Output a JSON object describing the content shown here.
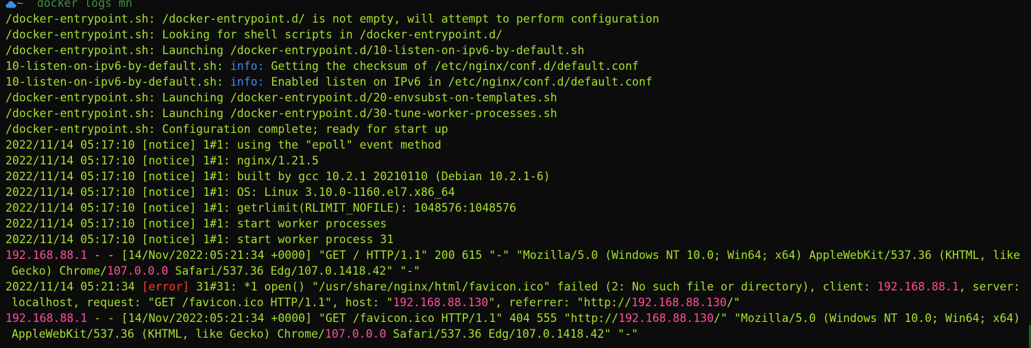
{
  "prompt": {
    "icon": "cloud-icon",
    "tilde": "~",
    "command": "docker logs mn"
  },
  "lines": [
    "/docker-entrypoint.sh: /docker-entrypoint.d/ is not empty, will attempt to perform configuration",
    "/docker-entrypoint.sh: Looking for shell scripts in /docker-entrypoint.d/",
    "/docker-entrypoint.sh: Launching /docker-entrypoint.d/10-listen-on-ipv6-by-default.sh"
  ],
  "info_lines": [
    {
      "prefix": "10-listen-on-ipv6-by-default.sh: ",
      "tag": "info:",
      "text": " Getting the checksum of /etc/nginx/conf.d/default.conf"
    },
    {
      "prefix": "10-listen-on-ipv6-by-default.sh: ",
      "tag": "info:",
      "text": " Enabled listen on IPv6 in /etc/nginx/conf.d/default.conf"
    }
  ],
  "lines2": [
    "/docker-entrypoint.sh: Launching /docker-entrypoint.d/20-envsubst-on-templates.sh",
    "/docker-entrypoint.sh: Launching /docker-entrypoint.d/30-tune-worker-processes.sh",
    "/docker-entrypoint.sh: Configuration complete; ready for start up",
    "2022/11/14 05:17:10 [notice] 1#1: using the \"epoll\" event method",
    "2022/11/14 05:17:10 [notice] 1#1: nginx/1.21.5",
    "2022/11/14 05:17:10 [notice] 1#1: built by gcc 10.2.1 20210110 (Debian 10.2.1-6)",
    "2022/11/14 05:17:10 [notice] 1#1: OS: Linux 3.10.0-1160.el7.x86_64",
    "2022/11/14 05:17:10 [notice] 1#1: getrlimit(RLIMIT_NOFILE): 1048576:1048576",
    "2022/11/14 05:17:10 [notice] 1#1: start worker processes",
    "2022/11/14 05:17:10 [notice] 1#1: start worker process 31"
  ],
  "access1": {
    "ip": "192.168.88.1",
    "rest1": " - - [14/Nov/2022:05:21:34 +0000] \"GET / HTTP/1.1\" 200 615 \"-\" \"Mozilla/5.0 (Windows NT 10.0; Win64; x64) AppleWebKit/537.36 (KHTML, like",
    "cont1": "Gecko) Chrome/",
    "chrome": "107.0.0.0",
    "cont2": " Safari/537.36 Edg/107.0.1418.42\" \"-\""
  },
  "error1": {
    "time": "2022/11/14 05:21:34 ",
    "tag": "[error]",
    "rest1": " 31#31: *1 open() \"/usr/share/nginx/html/favicon.ico\" failed (2: No such file or directory), client: ",
    "client": "192.168.88.1",
    "rest2": ", server:",
    "cont1": "localhost, request: \"GET /favicon.ico HTTP/1.1\", host: \"",
    "host": "192.168.88.130",
    "cont2": "\", referrer: \"http://",
    "referrer": "192.168.88.130",
    "cont3": "/\""
  },
  "access2": {
    "ip": "192.168.88.1",
    "rest1": " - - [14/Nov/2022:05:21:34 +0000] \"GET /favicon.ico HTTP/1.1\" 404 555 \"http://",
    "ref": "192.168.88.130",
    "rest2": "/\" \"Mozilla/5.0 (Windows NT 10.0; Win64; x64)",
    "cont1": "AppleWebKit/537.36 (KHTML, like Gecko) Chrome/",
    "chrome": "107.0.0.0",
    "cont2": " Safari/537.36 Edg/107.0.1418.42\" \"-\""
  },
  "colors": {
    "background": "#0c0c0c",
    "text": "#a6e22e",
    "ip": "#ff4f9a",
    "info": "#3b8eea",
    "error": "#ff3b30"
  }
}
